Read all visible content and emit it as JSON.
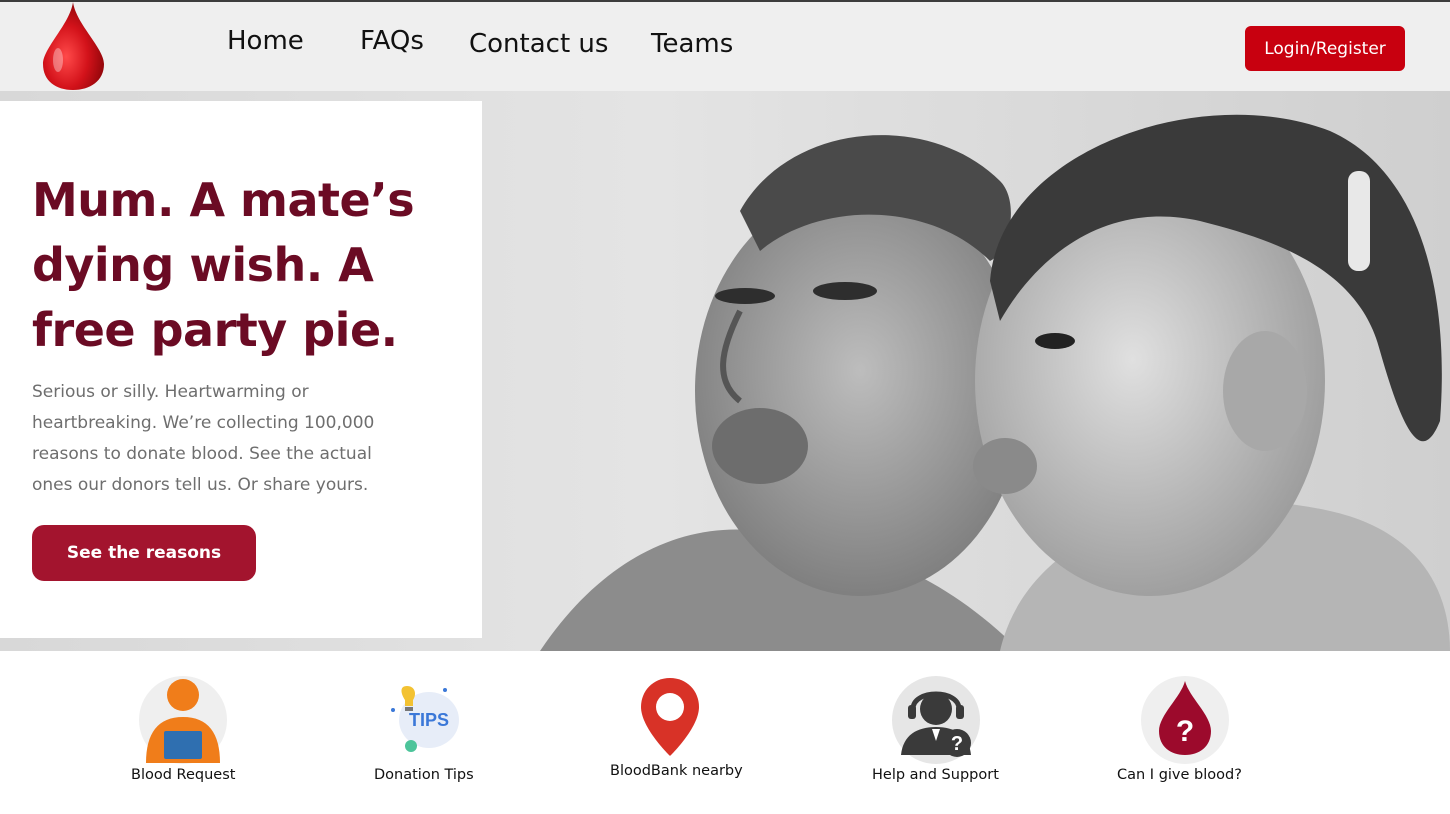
{
  "nav": {
    "links": [
      "Home",
      "FAQs",
      "Contact us",
      "Teams"
    ],
    "login_label": "Login/Register"
  },
  "colors": {
    "brand_red": "#c8000f",
    "title_maroon": "#6b0b24",
    "button_maroon": "#a3142e",
    "nav_bg": "#efefef"
  },
  "hero": {
    "title": "Mum. A mate’s dying wish. A free party pie.",
    "text": "Serious or silly. Heartwarming or heartbreaking. We’re collecting 100,000 reasons to donate blood. See the actual ones our donors tell us. Or share yours.",
    "button_label": "See the reasons",
    "image": "black-and-white photo of a woman and a young girl sticking out their tongues"
  },
  "services": [
    {
      "label": "Blood Request",
      "icon": "person-laptop-icon"
    },
    {
      "label": "Donation Tips",
      "icon": "tips-icon"
    },
    {
      "label": "BloodBank nearby",
      "icon": "map-pin-icon"
    },
    {
      "label": "Help and Support",
      "icon": "support-agent-icon"
    },
    {
      "label": "Can I give blood?",
      "icon": "blood-drop-question-icon"
    }
  ],
  "icons": {
    "logo": "blood-drop-logo",
    "tips_text": "TIPS",
    "question_mark": "?"
  }
}
